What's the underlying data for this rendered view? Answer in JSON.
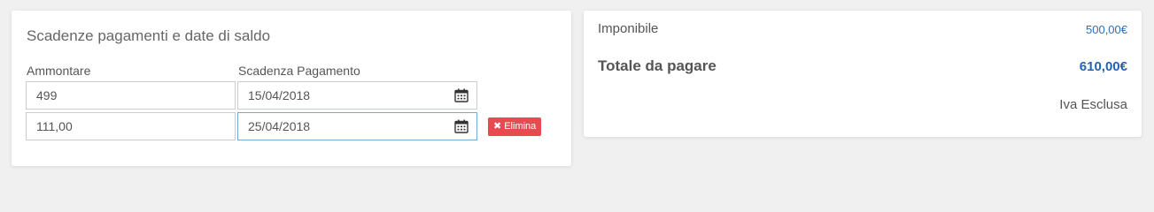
{
  "payments": {
    "title": "Scadenze pagamenti e date di saldo",
    "amount_label": "Ammontare",
    "due_date_label": "Scadenza Pagamento",
    "rows": [
      {
        "amount": "499",
        "due_date": "15/04/2018"
      },
      {
        "amount": "111,00",
        "due_date": "25/04/2018"
      }
    ],
    "delete_label": "Elimina",
    "delete_icon": "times-icon"
  },
  "summary": {
    "taxable_label": "Imponibile",
    "taxable_value": "500,00€",
    "total_label": "Totale da pagare",
    "total_value": "610,00€",
    "vat_note": "Iva Esclusa"
  },
  "colors": {
    "accent_blue": "#1f63b5",
    "danger_red": "#e84a52",
    "focus_border": "#7aa7cf"
  }
}
